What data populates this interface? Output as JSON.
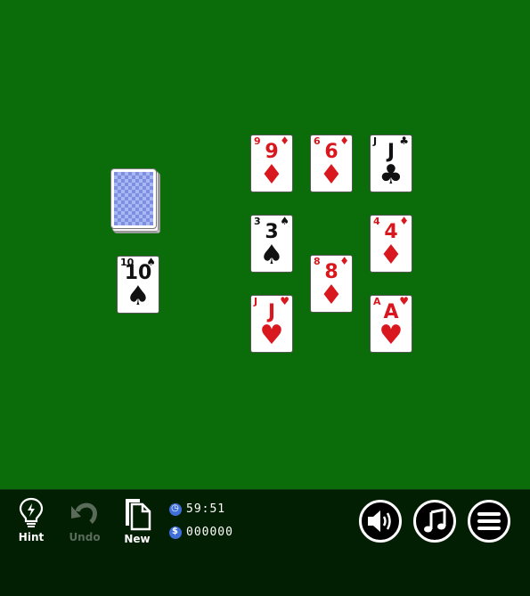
{
  "stock": {
    "icon": "card-back"
  },
  "waste": {
    "rank": "10",
    "suit": "♠",
    "color": "black"
  },
  "tableau": [
    {
      "rank": "9",
      "suit": "♦",
      "color": "red"
    },
    {
      "rank": "6",
      "suit": "♦",
      "color": "red"
    },
    {
      "rank": "J",
      "suit": "♣",
      "color": "black"
    },
    {
      "rank": "3",
      "suit": "♠",
      "color": "black"
    },
    {
      "rank": "4",
      "suit": "♦",
      "color": "red"
    },
    {
      "rank": "8",
      "suit": "♦",
      "color": "red"
    },
    {
      "rank": "J",
      "suit": "♥",
      "color": "red"
    },
    {
      "rank": "A",
      "suit": "♥",
      "color": "red"
    }
  ],
  "toolbar": {
    "hint_label": "Hint",
    "undo_label": "Undo",
    "new_label": "New",
    "time": "59:51",
    "score": "000000"
  },
  "icons": {
    "hint": "lightbulb-icon",
    "undo": "undo-arrow-icon",
    "new": "new-document-icon",
    "clock": "clock-icon",
    "score": "dollar-icon",
    "sound": "speaker-icon",
    "music": "music-note-icon",
    "menu": "hamburger-menu-icon"
  },
  "colors": {
    "felt": "#0a6d0a",
    "bar": "#031f03",
    "red_suit": "#d8181e",
    "accent": "#3f6fd8"
  }
}
